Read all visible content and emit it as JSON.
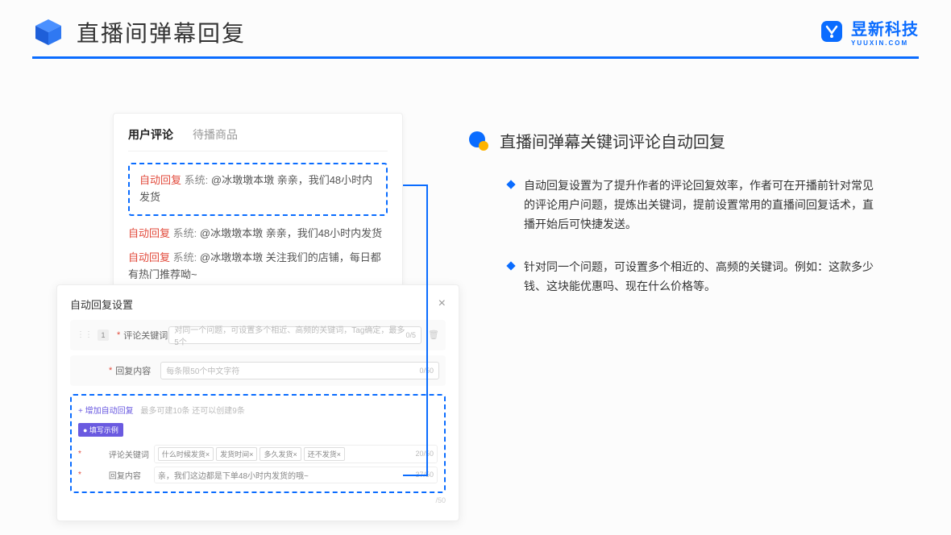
{
  "header": {
    "title": "直播间弹幕回复",
    "brand_name": "昱新科技",
    "brand_sub": "YUUXIN.COM"
  },
  "comments": {
    "tab_active": "用户评论",
    "tab_inactive": "待播商品",
    "tag": "自动回复",
    "sys": "系统:",
    "line1": "@冰墩墩本墩 亲亲，我们48小时内发货",
    "line2": "@冰墩墩本墩 亲亲，我们48小时内发货",
    "line3": "@冰墩墩本墩 关注我们的店铺，每日都有热门推荐呦~"
  },
  "settings": {
    "title": "自动回复设置",
    "idx": "1",
    "label_keyword": "评论关键词",
    "ph_keyword": "对同一个问题，可设置多个相近、高频的关键词，Tag确定，最多5个",
    "count_keyword": "0/5",
    "label_reply": "回复内容",
    "ph_reply": "每条限50个中文字符",
    "count_reply": "0/50",
    "add_link": "+ 增加自动回复",
    "add_hint": "最多可建10条 还可以创建9条",
    "example_pill": "● 填写示例",
    "ex_kw_label": "评论关键词",
    "ex_tags": [
      "什么时候发货×",
      "发货时间×",
      "多久发货×",
      "还不发货×"
    ],
    "ex_kw_count": "20/50",
    "ex_reply_label": "回复内容",
    "ex_reply_text": "亲，我们这边都是下单48小时内发货的哦~",
    "ex_reply_count": "37/50",
    "outer_count": "/50"
  },
  "right": {
    "section_title": "直播间弹幕关键词评论自动回复",
    "bullet1": "自动回复设置为了提升作者的评论回复效率，作者可在开播前针对常见的评论用户问题，提炼出关键词，提前设置常用的直播间回复话术，直播开始后可快捷发送。",
    "bullet2": "针对同一个问题，可设置多个相近的、高频的关键词。例如：这款多少钱、这块能优惠吗、现在什么价格等。"
  }
}
